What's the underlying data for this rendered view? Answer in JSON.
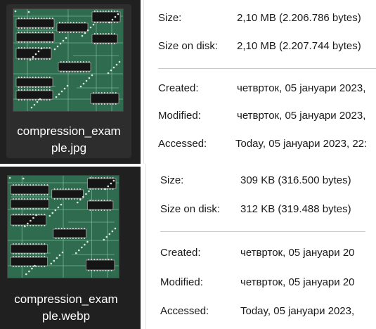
{
  "files": [
    {
      "name_line1": "compression_exam",
      "name_line2": "ple.jpg",
      "thumbnail": "circuit-board-image",
      "properties": {
        "size_label": "Size:",
        "size_value": "2,10 MB (2.206.786 bytes)",
        "size_on_disk_label": "Size on disk:",
        "size_on_disk_value": "2,10 MB (2.207.744 bytes)",
        "created_label": "Created:",
        "created_value": "четврток, 05 јануари 2023, ",
        "modified_label": "Modified:",
        "modified_value": "четврток, 05 јануари 2023, ",
        "accessed_label": "Accessed:",
        "accessed_value": "Today, 05 јануари 2023, 22:"
      }
    },
    {
      "name_line1": "compression_exam",
      "name_line2": "ple.webp",
      "thumbnail": "circuit-board-image",
      "properties": {
        "size_label": "Size:",
        "size_value": "309 KB (316.500 bytes)",
        "size_on_disk_label": "Size on disk:",
        "size_on_disk_value": "312 KB (319.488 bytes)",
        "created_label": "Created:",
        "created_value": "четврток, 05 јануари 20",
        "modified_label": "Modified:",
        "modified_value": "четврток, 05 јануари 20",
        "accessed_label": "Accessed:",
        "accessed_value": "Today, 05 јануари 2023, "
      }
    }
  ],
  "colors": {
    "tile_bg": "#202020",
    "tile_selected": "#2d2d2d",
    "board_green": "#2f6b4e",
    "chip_black": "#151515",
    "text_dark": "#1a1a1a"
  }
}
